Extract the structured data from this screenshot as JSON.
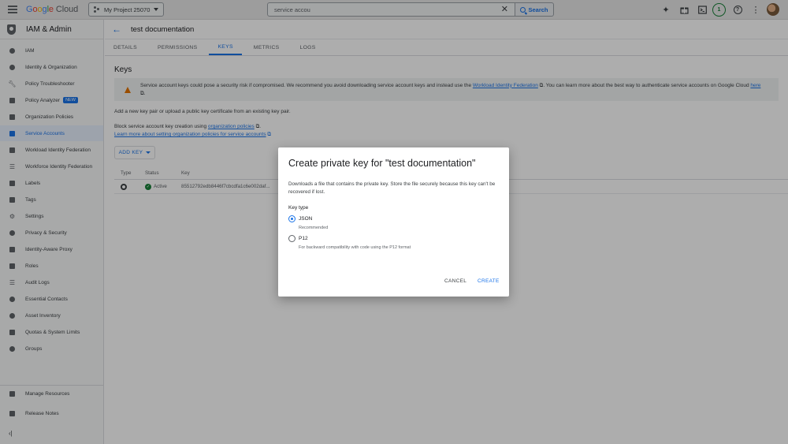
{
  "topbar": {
    "logo": {
      "g": "G",
      "o1": "o",
      "o2": "o",
      "g2": "g",
      "l": "l",
      "e": "e",
      "cloud": " Cloud"
    },
    "project": "My Project 25070",
    "search_value": "service accou",
    "search_button": "Search",
    "notifications_count": "1"
  },
  "sidebar": {
    "title": "IAM & Admin",
    "items": [
      {
        "label": "IAM",
        "icon": "person-add-icon"
      },
      {
        "label": "Identity & Organization",
        "icon": "account-circle-icon"
      },
      {
        "label": "Policy Troubleshooter",
        "icon": "wrench-icon"
      },
      {
        "label": "Policy Analyzer",
        "icon": "search-document-icon",
        "badge": "NEW"
      },
      {
        "label": "Organization Policies",
        "icon": "document-icon"
      },
      {
        "label": "Service Accounts",
        "icon": "service-account-icon",
        "active": true
      },
      {
        "label": "Workload Identity Federation",
        "icon": "id-card-icon"
      },
      {
        "label": "Workforce Identity Federation",
        "icon": "list-icon"
      },
      {
        "label": "Labels",
        "icon": "label-icon"
      },
      {
        "label": "Tags",
        "icon": "tag-icon"
      },
      {
        "label": "Settings",
        "icon": "settings-icon"
      },
      {
        "label": "Privacy & Security",
        "icon": "shield-icon"
      },
      {
        "label": "Identity-Aware Proxy",
        "icon": "proxy-icon"
      },
      {
        "label": "Roles",
        "icon": "roles-icon"
      },
      {
        "label": "Audit Logs",
        "icon": "list-lines-icon"
      },
      {
        "label": "Essential Contacts",
        "icon": "contacts-icon"
      },
      {
        "label": "Asset Inventory",
        "icon": "inventory-icon"
      },
      {
        "label": "Quotas & System Limits",
        "icon": "quota-icon"
      },
      {
        "label": "Groups",
        "icon": "groups-icon"
      }
    ],
    "footer": [
      {
        "label": "Manage Resources",
        "icon": "folder-icon"
      },
      {
        "label": "Release Notes",
        "icon": "notes-icon"
      }
    ],
    "collapse": "‹|"
  },
  "header": {
    "title": "test documentation",
    "tabs": [
      "DETAILS",
      "PERMISSIONS",
      "KEYS",
      "METRICS",
      "LOGS"
    ],
    "active_tab": "KEYS"
  },
  "keys": {
    "title": "Keys",
    "warning": {
      "text_before": "Service account keys could pose a security risk if compromised. We recommend you avoid downloading service account keys and instead use the ",
      "link1": "Workload Identity Federation",
      "text_middle": ". You can learn more about the best way to authenticate service accounts on Google Cloud ",
      "link2": "here",
      "text_after": "."
    },
    "add_text": "Add a new key pair or upload a public key certificate from an existing key pair.",
    "block_text": "Block service account key creation using ",
    "block_link": "organization policies",
    "learn_link": "Learn more about setting organization policies for service accounts",
    "add_key_button": "ADD KEY",
    "table": {
      "headers": [
        "Type",
        "Status",
        "Key"
      ],
      "rows": [
        {
          "status": "Active",
          "key": "85512792edb8446f7cbcdfa1c6e002daf..."
        }
      ]
    }
  },
  "dialog": {
    "title": "Create private key for \"test documentation\"",
    "description": "Downloads a file that contains the private key. Store the file securely because this key can't be recovered if lost.",
    "key_type_label": "Key type",
    "options": [
      {
        "label": "JSON",
        "hint": "Recommended",
        "selected": true
      },
      {
        "label": "P12",
        "hint": "For backward compatibility with code using the P12 format",
        "selected": false
      }
    ],
    "cancel": "CANCEL",
    "create": "CREATE"
  },
  "colors": {
    "accent": "#1a73e8",
    "warning": "#e37400",
    "success": "#188038"
  }
}
